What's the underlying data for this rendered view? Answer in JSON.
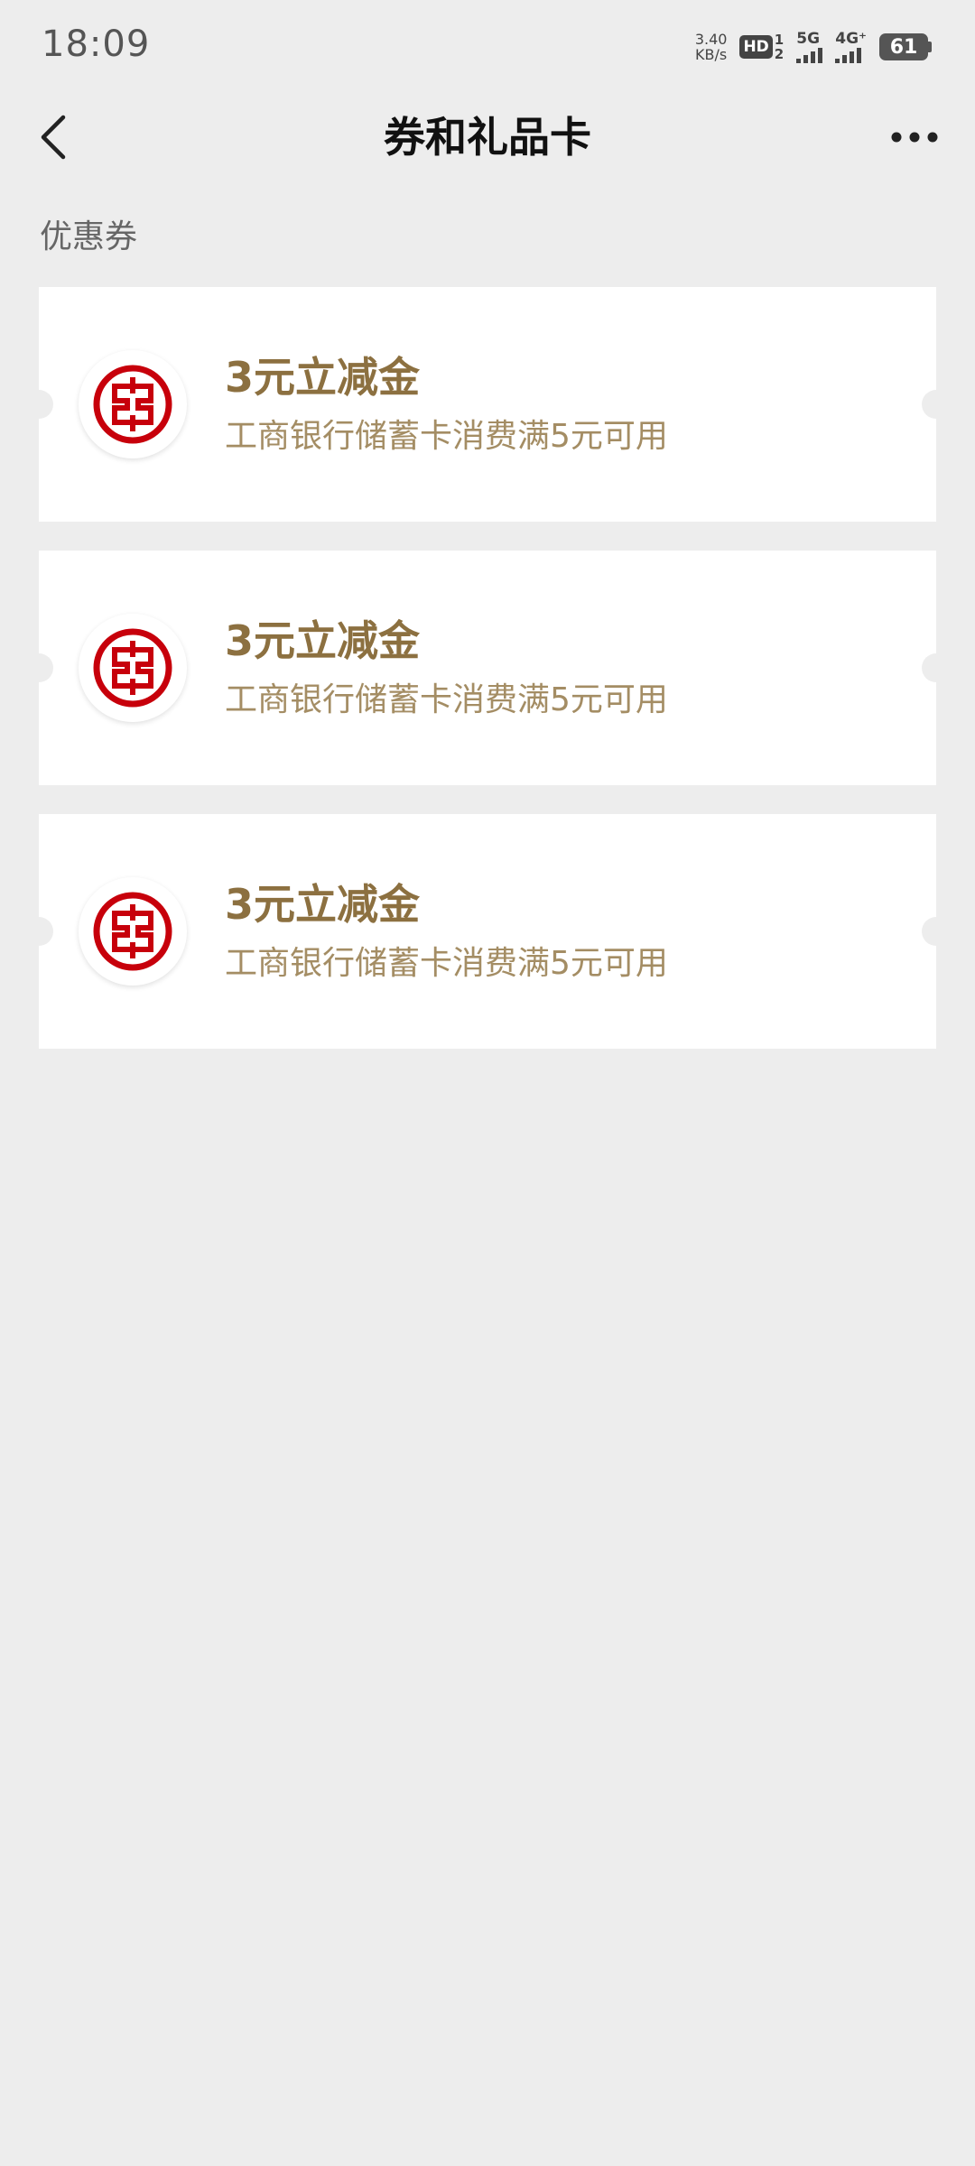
{
  "status_bar": {
    "time": "18:09",
    "net_speed_value": "3.40",
    "net_speed_unit": "KB/s",
    "hd_label": "HD",
    "hd_sub_top": "1",
    "hd_sub_bottom": "2",
    "signal1_label": "5G",
    "signal2_label": "4G⁺",
    "battery_level": "61"
  },
  "nav": {
    "title": "券和礼品卡",
    "back_icon": "chevron-left-icon",
    "more_icon": "more-dots-icon"
  },
  "section": {
    "label": "优惠券"
  },
  "coupons": [
    {
      "title": "3元立减金",
      "description": "工商银行储蓄卡消费满5元可用",
      "logo_icon": "icbc-logo-icon"
    },
    {
      "title": "3元立减金",
      "description": "工商银行储蓄卡消费满5元可用",
      "logo_icon": "icbc-logo-icon"
    },
    {
      "title": "3元立减金",
      "description": "工商银行储蓄卡消费满5元可用",
      "logo_icon": "icbc-logo-icon"
    }
  ],
  "colors": {
    "background": "#ededed",
    "card": "#ffffff",
    "coupon_title": "#8c7040",
    "coupon_desc": "#a48d64",
    "icbc_red": "#c7000b"
  }
}
